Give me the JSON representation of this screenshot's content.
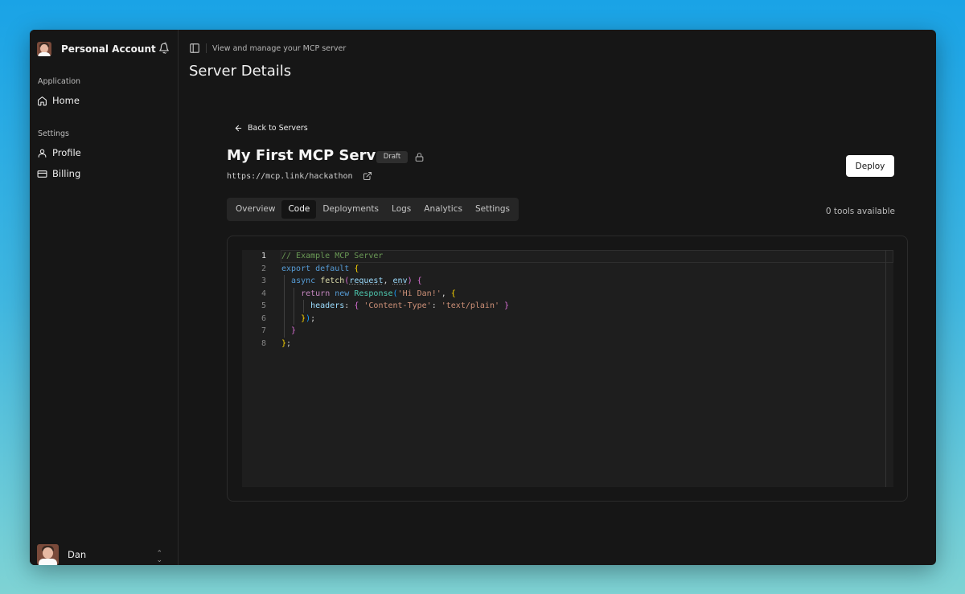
{
  "sidebar": {
    "account_name": "Personal Account",
    "sections": [
      {
        "label": "Application",
        "items": [
          {
            "label": "Home",
            "icon": "home-icon"
          }
        ]
      },
      {
        "label": "Settings",
        "items": [
          {
            "label": "Profile",
            "icon": "user-icon"
          },
          {
            "label": "Billing",
            "icon": "credit-card-icon"
          }
        ]
      }
    ],
    "user_name": "Dan"
  },
  "header": {
    "subtitle": "View and manage your MCP server",
    "title": "Server Details"
  },
  "server": {
    "back_label": "Back to Servers",
    "name": "My First MCP Server",
    "status": "Draft",
    "url": "https://mcp.link/hackathon",
    "deploy_label": "Deploy",
    "tools_available": "0 tools available"
  },
  "tabs": [
    {
      "label": "Overview",
      "active": false
    },
    {
      "label": "Code",
      "active": true
    },
    {
      "label": "Deployments",
      "active": false
    },
    {
      "label": "Logs",
      "active": false
    },
    {
      "label": "Analytics",
      "active": false
    },
    {
      "label": "Settings",
      "active": false
    }
  ],
  "editor": {
    "current_line": 1,
    "line_numbers": [
      "1",
      "2",
      "3",
      "4",
      "5",
      "6",
      "7",
      "8"
    ],
    "lines": [
      "// Example MCP Server",
      "export default {",
      "  async fetch(request, env) {",
      "    return new Response('Hi Dan!', {",
      "      headers: { 'Content-Type': 'text/plain' }",
      "    });",
      "  }",
      "};"
    ]
  },
  "colors": {
    "background": "#161616",
    "editor_background": "#1e1e1e",
    "accent_button": "#ffffff",
    "comment": "#6a9955",
    "keyword": "#569cd6",
    "string": "#ce9178"
  }
}
